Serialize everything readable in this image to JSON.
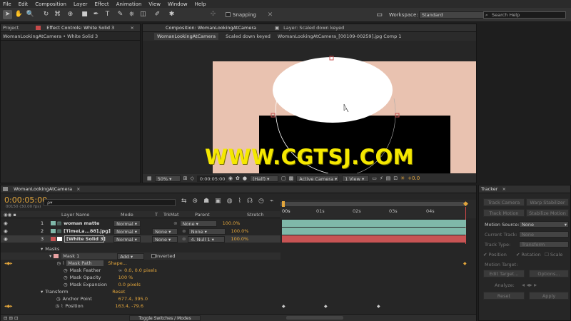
{
  "menu": [
    "File",
    "Edit",
    "Composition",
    "Layer",
    "Effect",
    "Animation",
    "View",
    "Window",
    "Help"
  ],
  "toolbar": {
    "snapping_label": "Snapping",
    "workspace_label": "Workspace:",
    "workspace_value": "Standard",
    "search_placeholder": "Search Help"
  },
  "left_panel": {
    "tab_project": "Project",
    "tab_effect_controls": "Effect Controls: White Solid 3",
    "breadcrumb": "WomanLookingAtCamera • White Solid 3"
  },
  "comp_panel": {
    "tab_composition": "Composition: WomanLookingAtCamera",
    "tab_layer": "Layer: Scaled down keyed",
    "flow": [
      "WomanLookingAtCamera",
      "Scaled down keyed",
      "WomanLookingAtCamera_[00109-00259].jpg Comp 1"
    ],
    "zoom": "50%",
    "timecode": "0:00:05:00",
    "resolution": "(Half)",
    "camera": "Active Camera",
    "view": "1 View",
    "exposure": "+0.0",
    "watermark": "WWW.CGTSJ.COM",
    "colors": {
      "bg": "#e9c2b0",
      "shape": "#ffffff",
      "dark": "#000000",
      "watermark": "#f5e800"
    }
  },
  "timeline": {
    "tab": "WomanLookingAtCamera",
    "timecode": "0:00:05:00",
    "fps": "00150 (30.00 fps)",
    "search_placeholder": "ρ▾",
    "columns": {
      "layer_name": "Layer Name",
      "mode": "Mode",
      "t": "T",
      "trkmat": "TrkMat",
      "parent": "Parent",
      "stretch": "Stretch"
    },
    "ruler": [
      "00s",
      "01s",
      "02s",
      "03s",
      "04s"
    ],
    "layers": [
      {
        "num": "1",
        "name": "woman matte",
        "mode": "Normal",
        "trkmat": "",
        "parent": "None",
        "stretch": "100.0%",
        "color": "#7fb8a9"
      },
      {
        "num": "2",
        "name": "[TimeLa...88].jpg]",
        "mode": "Normal",
        "trkmat": "None",
        "parent": "None",
        "stretch": "100.0%",
        "color": "#7fb8a9"
      },
      {
        "num": "3",
        "name": "[White Solid 3]",
        "mode": "Normal",
        "trkmat": "None",
        "parent": "4. Null 1",
        "stretch": "100.0%",
        "color": "#c85454"
      }
    ],
    "masks_label": "Masks",
    "mask1": {
      "name": "Mask 1",
      "mode": "Add",
      "inverted": "Inverted"
    },
    "props": [
      {
        "name": "Mask Path",
        "value": "Shape..."
      },
      {
        "name": "Mask Feather",
        "value": "0.0, 0.0 pixels"
      },
      {
        "name": "Mask Opacity",
        "value": "100 %"
      },
      {
        "name": "Mask Expansion",
        "value": "0.0  pixels"
      }
    ],
    "transform_label": "Transform",
    "reset_label": "Reset",
    "anchor": {
      "name": "Anchor Point",
      "value": "677.4, 395.0"
    },
    "position": {
      "name": "Position",
      "value": "163.4, -79.6"
    },
    "toggle_label": "Toggle Switches / Modes"
  },
  "tracker": {
    "tab": "Tracker",
    "track_camera": "Track Camera",
    "warp_stabilizer": "Warp Stabilizer",
    "track_motion": "Track Motion",
    "stabilize_motion": "Stabilize Motion",
    "motion_source_label": "Motion Source:",
    "motion_source_value": "None",
    "current_track_label": "Current Track:",
    "current_track_value": "None",
    "track_type_label": "Track Type:",
    "track_type_value": "Transform",
    "position_label": "Position",
    "rotation_label": "Rotation",
    "scale_label": "Scale",
    "motion_target_label": "Motion Target:",
    "edit_target": "Edit Target...",
    "options": "Options...",
    "analyze_label": "Analyze:",
    "reset": "Reset",
    "apply": "Apply"
  }
}
